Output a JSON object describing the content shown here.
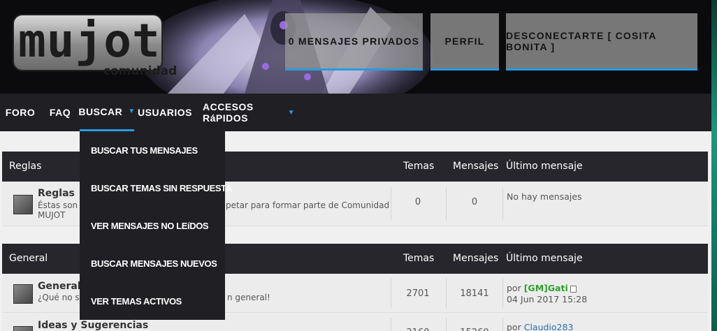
{
  "logo": {
    "main": "MUJOT",
    "sub": "comunidad"
  },
  "header": {
    "buttons": [
      {
        "label": "0 Mensajes privados"
      },
      {
        "label": "Perfil"
      },
      {
        "label": "Desconectarte [ Cosita Bonita ]"
      }
    ]
  },
  "nav": {
    "items": [
      {
        "label": "FORO"
      },
      {
        "label": "FAQ"
      },
      {
        "label": "BUSCAR"
      },
      {
        "label": "USUARIOS"
      },
      {
        "label": "ACCESOS RáPIDOS"
      }
    ],
    "active": "BUSCAR"
  },
  "dropdown": {
    "items": [
      {
        "label": "BUSCAR TUS MENSAJES"
      },
      {
        "label": "BUSCAR TEMAS SIN RESPUESTA"
      },
      {
        "label": "VER MENSAJES NO LEíDOS"
      },
      {
        "label": "BUSCAR MENSAJES NUEVOS"
      },
      {
        "label": "VER TEMAS ACTIVOS"
      }
    ]
  },
  "categories": [
    {
      "title": "Reglas",
      "col_temas": "Temas",
      "col_mensajes": "Mensajes",
      "col_ultimo": "Último mensaje",
      "forums": [
        {
          "name": "Reglas",
          "desc_left": "Éstas son",
          "desc_right": "petar para formar parte de Comunidad",
          "desc_line2": "MUJOT",
          "temas": "0",
          "mensajes": "0",
          "last_text": "No hay mensajes"
        }
      ]
    },
    {
      "title": "General",
      "col_temas": "Temas",
      "col_mensajes": "Mensajes",
      "col_ultimo": "Último mensaje",
      "forums": [
        {
          "name": "General",
          "desc_left": "¿Qué no s",
          "desc_right": "n general!",
          "temas": "2701",
          "mensajes": "18141",
          "last_by": "por",
          "last_user": "[GM]Gati",
          "last_date": "04 Jun 2017 15:28"
        },
        {
          "name": "Ideas y Sugerencias",
          "temas": "2160",
          "mensajes": "15260",
          "last_by": "por",
          "last_user": "Claudio283"
        }
      ]
    }
  ],
  "colors": {
    "accent": "#2a9ae0",
    "nav_bg": "#1f1f24",
    "header_bg": "#0b0b0e",
    "user_green": "#2fa22f",
    "user_blue": "#2a6db5"
  }
}
